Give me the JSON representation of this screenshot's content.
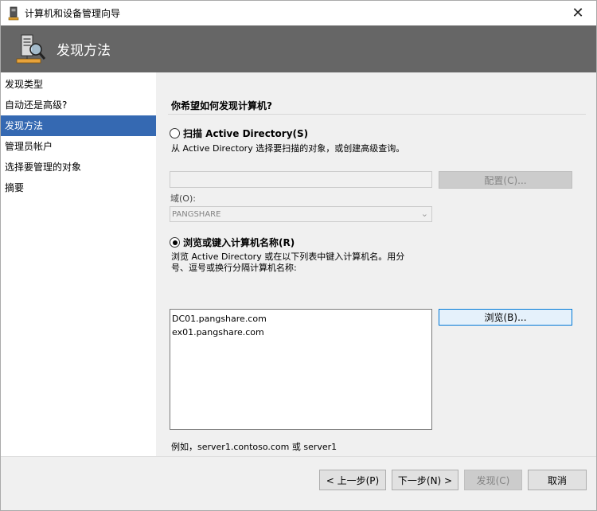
{
  "window": {
    "title": "计算机和设备管理向导",
    "close_glyph": "✕"
  },
  "header": {
    "title": "发现方法",
    "icon": "computer-tower-magnifier-icon"
  },
  "sidebar": {
    "items": [
      {
        "label": "发现类型",
        "active": false
      },
      {
        "label": "自动还是高级?",
        "active": false
      },
      {
        "label": "发现方法",
        "active": true
      },
      {
        "label": "管理员帐户",
        "active": false
      },
      {
        "label": "选择要管理的对象",
        "active": false
      },
      {
        "label": "摘要",
        "active": false
      }
    ]
  },
  "main": {
    "question": "你希望如何发现计算机?",
    "scan_option": {
      "label": "扫描 Active Directory(S)",
      "checked": false,
      "description": "从 Active Directory 选择要扫描的对象，或创建高级查询。",
      "configure_button": "配置(C)...",
      "domain_label": "域(O):",
      "domain_value": "PANGSHARE"
    },
    "browse_option": {
      "label": "浏览或键入计算机名称(R)",
      "checked": true,
      "description_line1": "浏览 Active Directory 或在以下列表中键入计算机名。用分",
      "description_line2": "号、逗号或换行分隔计算机名称:",
      "computer_names": [
        "DC01.pangshare.com",
        "ex01.pangshare.com"
      ],
      "browse_button": "浏览(B)...",
      "example": "例如，server1.contoso.com 或 server1"
    }
  },
  "footer": {
    "back_button": "< 上一步(P)",
    "next_button": "下一步(N) >",
    "discover_button": "发现(C)",
    "cancel_button": "取消"
  },
  "colors": {
    "header_bg": "#666666",
    "nav_active": "#3569b2",
    "content_bg": "#f0f0f0",
    "focus_border": "#0078d7"
  }
}
